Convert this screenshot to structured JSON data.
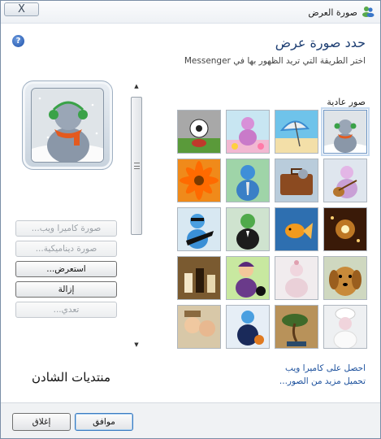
{
  "window": {
    "title": "صورة العرض",
    "close_label": "X"
  },
  "header": {
    "heading": "حدد صورة عرض",
    "subtext": "اختر الطريقة التي تريد الظهور بها في Messenger"
  },
  "side_buttons": {
    "webcam": "صورة كاميرا ويب...",
    "dynamic": "صورة ديناميكية...",
    "browse": "استعرض...",
    "remove": "إزالة",
    "edit": "تعدي..."
  },
  "watermark": "منتديات الشادن",
  "gallery": {
    "section_label": "صور عادية",
    "tiles": [
      {
        "id": "snowman-avatar",
        "selected": true
      },
      {
        "id": "beach-umbrella",
        "selected": false
      },
      {
        "id": "flower-avatar",
        "selected": false
      },
      {
        "id": "soccer-ball",
        "selected": false
      },
      {
        "id": "guitar-avatar",
        "selected": false
      },
      {
        "id": "suitcase-avatar",
        "selected": false
      },
      {
        "id": "tie-avatar",
        "selected": false
      },
      {
        "id": "orange-flower",
        "selected": false
      },
      {
        "id": "sparkles",
        "selected": false
      },
      {
        "id": "goldfish",
        "selected": false
      },
      {
        "id": "suit-avatar",
        "selected": false
      },
      {
        "id": "rock-guitar-avatar",
        "selected": false
      },
      {
        "id": "puppy",
        "selected": false
      },
      {
        "id": "pink-avatar",
        "selected": false
      },
      {
        "id": "cat-avatar",
        "selected": false
      },
      {
        "id": "chess",
        "selected": false
      },
      {
        "id": "chef-avatar",
        "selected": false
      },
      {
        "id": "bonsai",
        "selected": false
      },
      {
        "id": "basketball-avatar",
        "selected": false
      },
      {
        "id": "children-photo",
        "selected": false
      }
    ]
  },
  "links": {
    "get_webcam": "احصل على كاميرا ويب",
    "more_pictures": "تحميل مزيد من الصور..."
  },
  "footer": {
    "ok_label": "موافق",
    "close_label": "إغلاق"
  }
}
